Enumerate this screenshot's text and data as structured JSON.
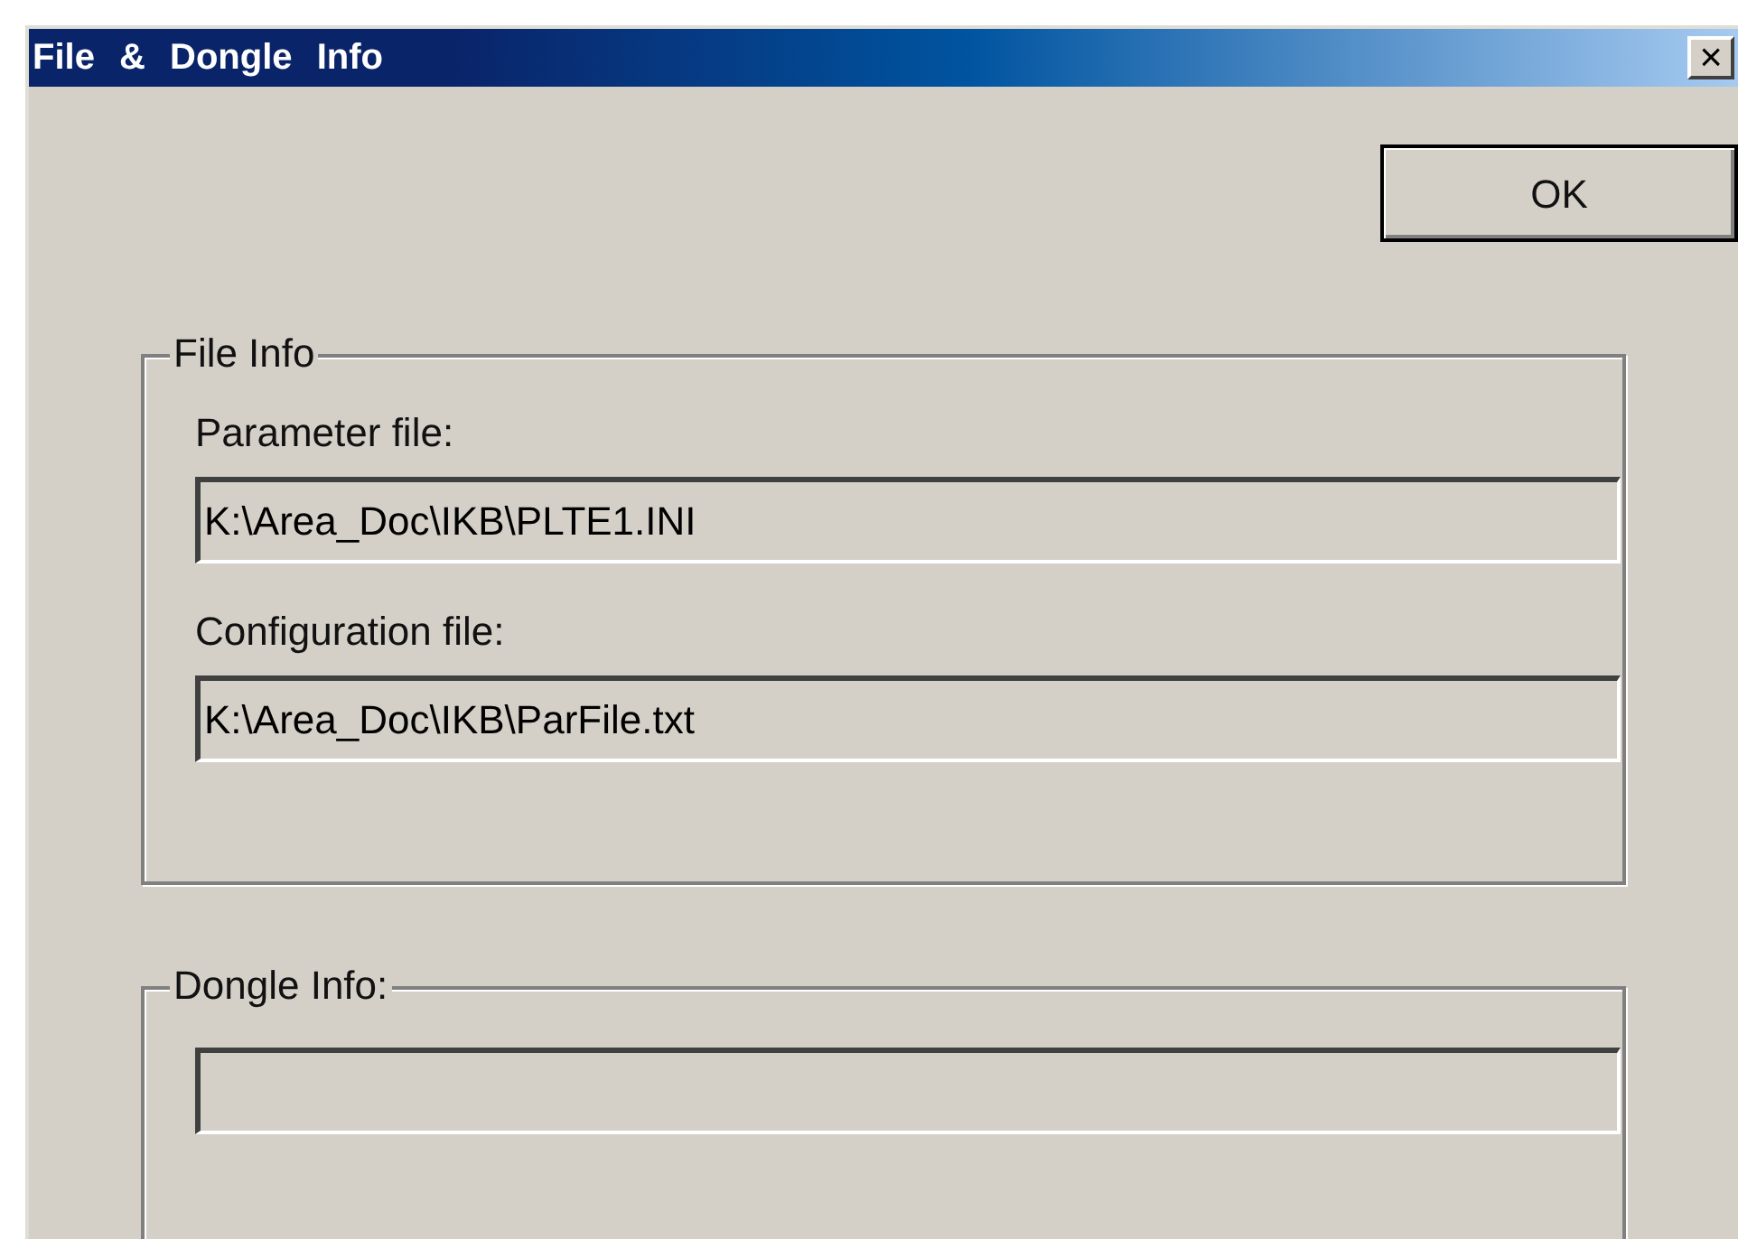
{
  "window": {
    "title": "File & Dongle Info",
    "close": "×"
  },
  "ok_button": {
    "label": "OK"
  },
  "file_info": {
    "title": "File Info",
    "fields": [
      {
        "label": "Parameter file:",
        "value": "K:\\Area_Doc\\IKB\\PLTE1.INI"
      },
      {
        "label": "Configuration file:",
        "value": "K:\\Area_Doc\\IKB\\ParFile.txt"
      }
    ]
  },
  "dongle_info": {
    "title": "Dongle Info:"
  }
}
